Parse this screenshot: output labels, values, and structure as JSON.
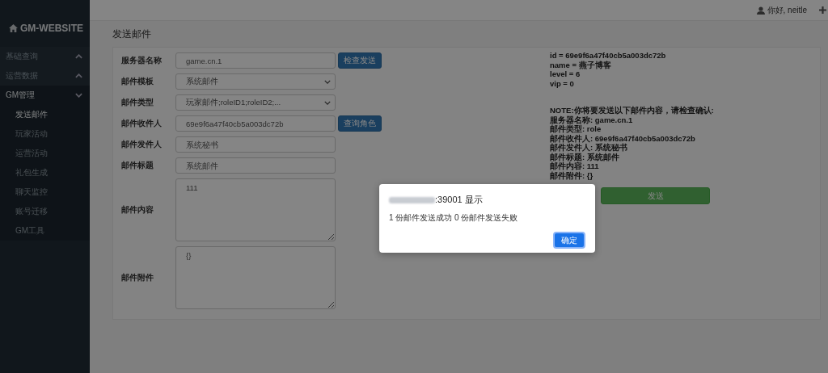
{
  "brand": {
    "title": "GM-WEBSITE"
  },
  "top_bar": {
    "greeting": "你好, neitle"
  },
  "sidebar": {
    "items": [
      {
        "label": "基础查询",
        "expanded": false
      },
      {
        "label": "运营数据",
        "expanded": false
      },
      {
        "label": "GM管理",
        "expanded": true,
        "children": [
          {
            "label": "发送邮件",
            "selected": true
          },
          {
            "label": "玩家活动",
            "selected": false
          },
          {
            "label": "运营活动",
            "selected": false
          },
          {
            "label": "礼包生成",
            "selected": false
          },
          {
            "label": "聊天监控",
            "selected": false
          },
          {
            "label": "账号迁移",
            "selected": false
          },
          {
            "label": "GM工具",
            "selected": false
          }
        ]
      }
    ]
  },
  "page_title": "发送邮件",
  "form": {
    "fields": [
      {
        "label": "服务器名称",
        "kind": "text",
        "value": "game.cn.1",
        "button": "检查发送"
      },
      {
        "label": "邮件模板",
        "kind": "select",
        "value": "系统邮件"
      },
      {
        "label": "邮件类型",
        "kind": "select",
        "value": "玩家邮件;roleID1;roleID2;..."
      },
      {
        "label": "邮件收件人",
        "kind": "text",
        "value": "69e9f6a47f40cb5a003dc72b",
        "button": "查询角色"
      },
      {
        "label": "邮件发件人",
        "kind": "text",
        "placeholder": "系统秘书"
      },
      {
        "label": "邮件标题",
        "kind": "text",
        "placeholder": "系统邮件"
      },
      {
        "label": "邮件内容",
        "kind": "textarea",
        "value": "111"
      },
      {
        "label": "邮件附件",
        "kind": "textarea",
        "placeholder": "{}"
      }
    ]
  },
  "role_info": [
    "id = 69e9f6a47f40cb5a003dc72b",
    "name = 燕子博客",
    "level = 6",
    "vip = 0"
  ],
  "confirmation": [
    "NOTE:你将要发送以下邮件内容，请检查确认:",
    "服务器名称: game.cn.1",
    "邮件类型: role",
    "邮件收件人: 69e9f6a47f40cb5a003dc72b",
    "邮件发件人: 系统秘书",
    "邮件标题: 系统邮件",
    "邮件内容: 111",
    "邮件附件: {}"
  ],
  "send_button": "发送",
  "dialog": {
    "title": ":39001 显示",
    "message": "1 份邮件发送成功 0 份邮件发送失败",
    "ok_button": "确定"
  }
}
